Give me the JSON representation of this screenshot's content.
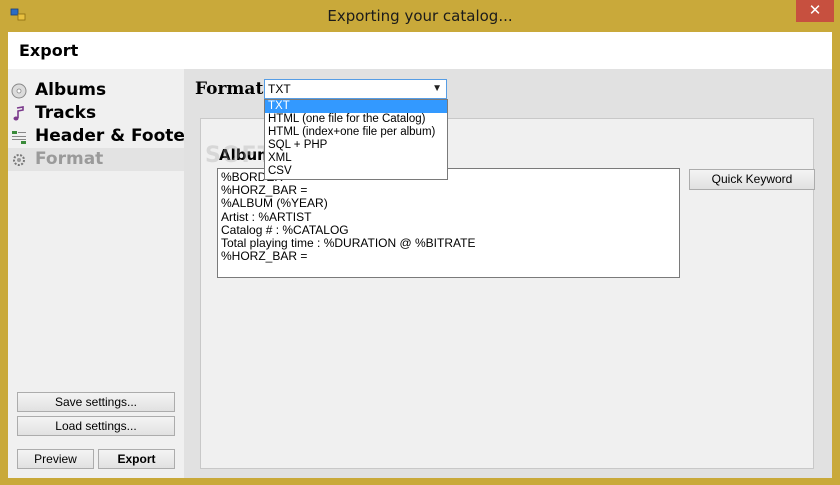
{
  "window": {
    "title": "Exporting your catalog...",
    "close_glyph": "✕"
  },
  "header": {
    "title": "Export"
  },
  "sidebar": {
    "items": [
      {
        "label": "Albums",
        "icon": "cd-icon"
      },
      {
        "label": "Tracks",
        "icon": "music-note-icon"
      },
      {
        "label": "Header & Footer",
        "icon": "header-footer-icon"
      },
      {
        "label": "Format",
        "icon": "gear-icon",
        "active": true
      }
    ],
    "save_settings": "Save settings...",
    "load_settings": "Load settings...",
    "preview": "Preview",
    "export": "Export"
  },
  "format": {
    "label": "Format",
    "selected": "TXT",
    "options": [
      "TXT",
      "HTML (one file for the Catalog)",
      "HTML (index+one file per album)",
      "SQL + PHP",
      "XML",
      "CSV"
    ]
  },
  "album_panel": {
    "title": "Album",
    "template_lines": [
      "%BORDER",
      "%HORZ_BAR =",
      "%ALBUM (%YEAR)",
      "Artist : %ARTIST",
      "Catalog # : %CATALOG",
      "Total playing time : %DURATION @ %BITRATE",
      "%HORZ_BAR ="
    ],
    "quick_keyword": "Quick Keyword"
  },
  "watermark": "SOFTPEDIA",
  "colors": {
    "titlebar": "#c9a93a",
    "close": "#c7503f",
    "selection": "#3399ff"
  }
}
